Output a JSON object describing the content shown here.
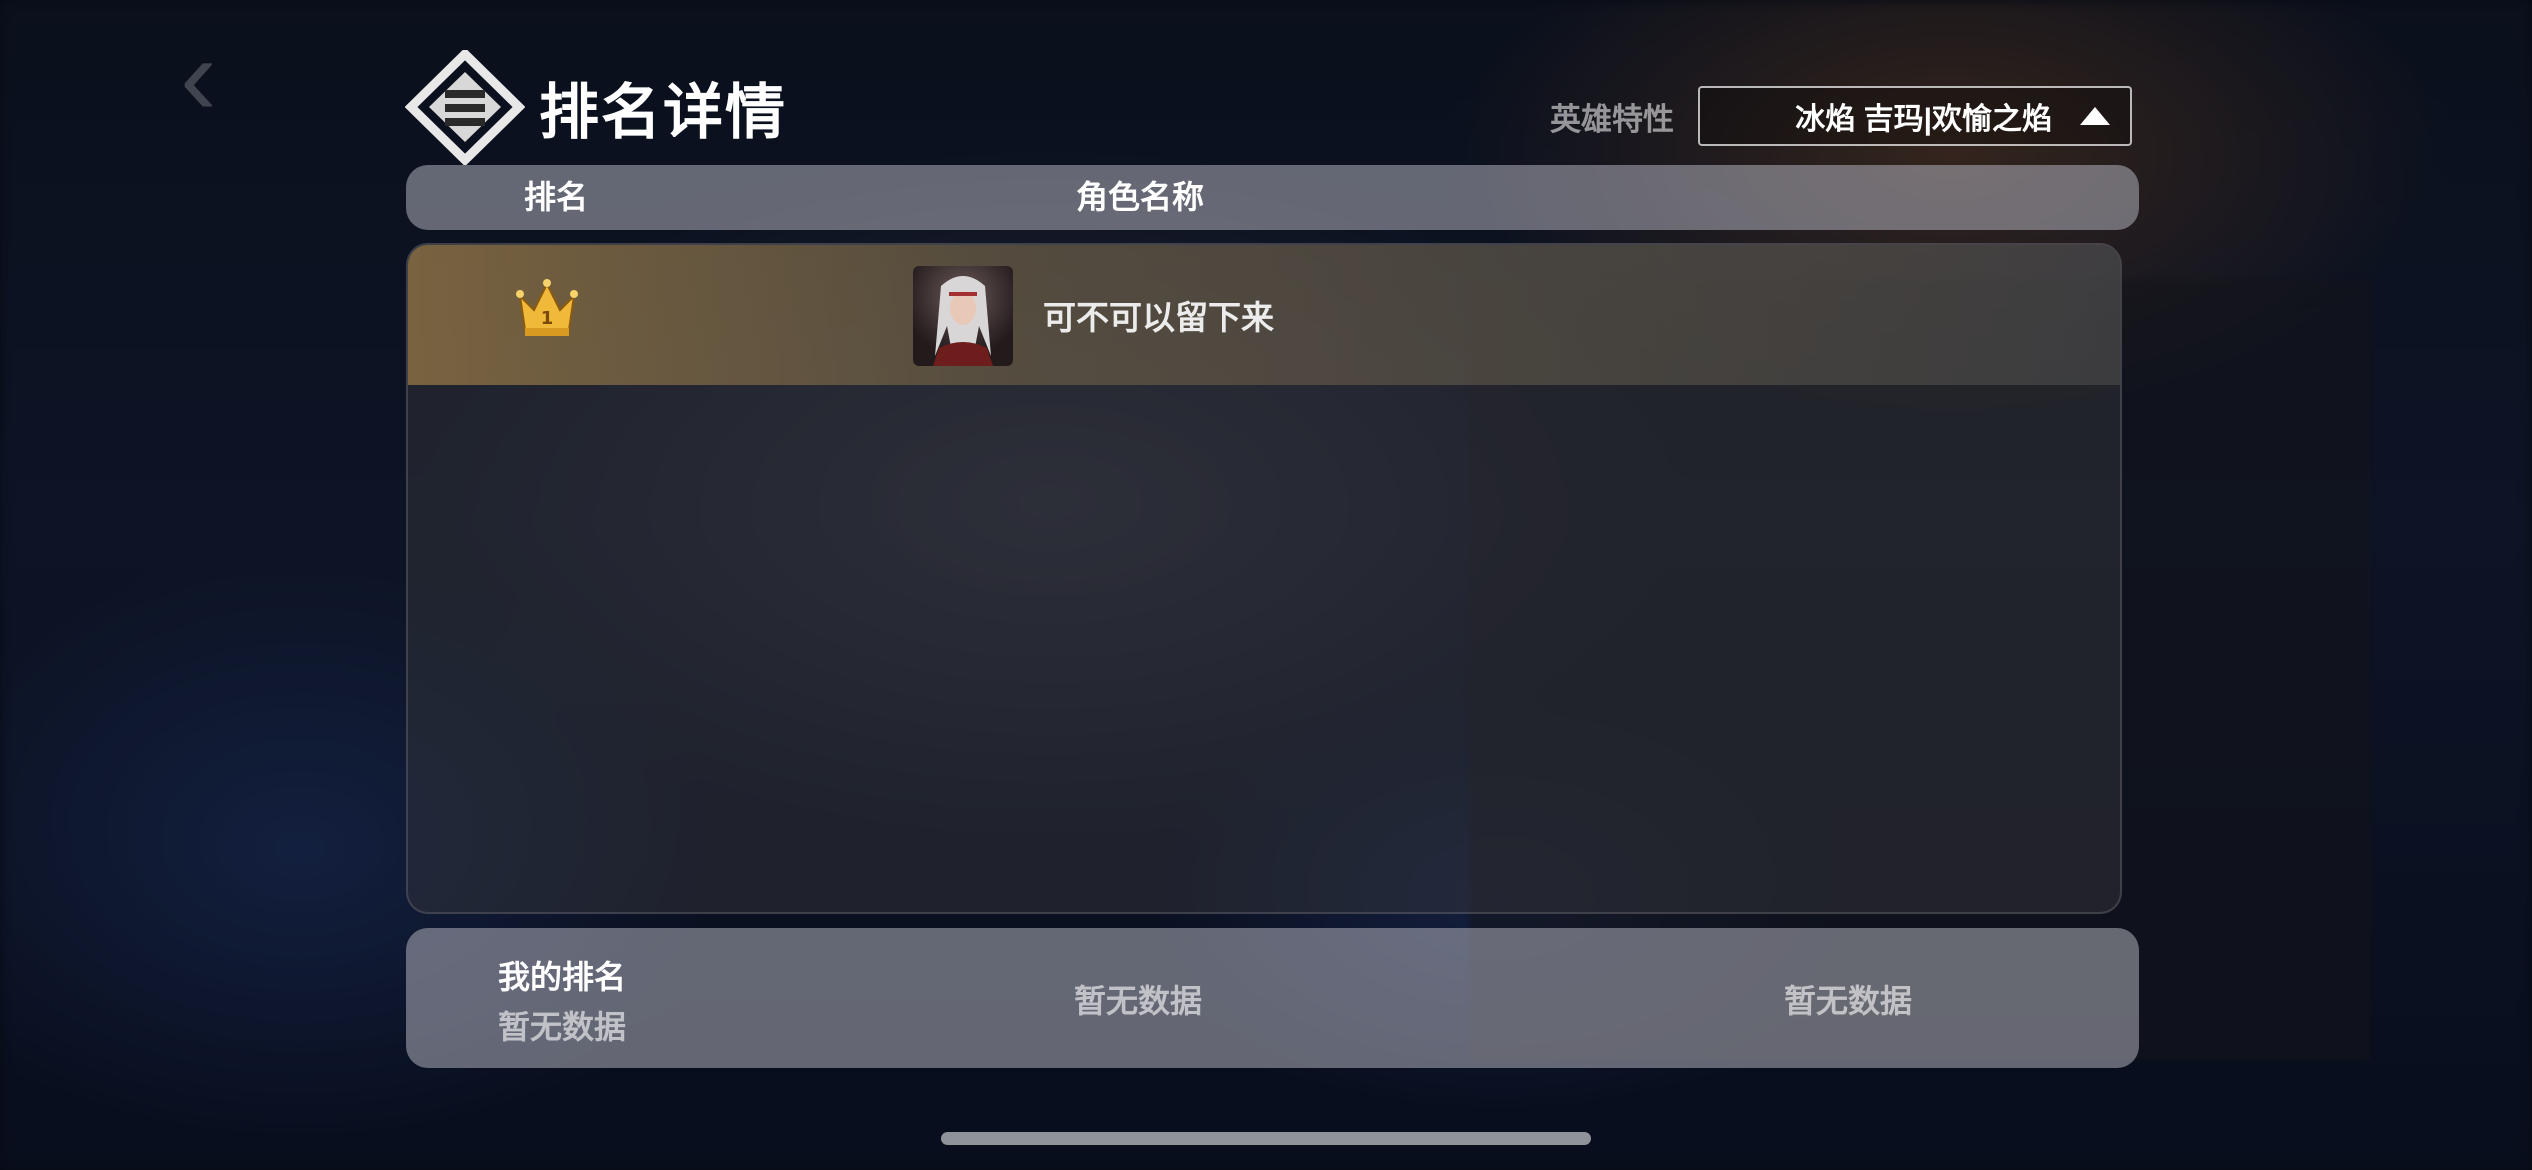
{
  "header": {
    "title": "排名详情",
    "filter_label": "英雄特性",
    "filter_value": "冰焰 吉玛|欢愉之焰"
  },
  "table": {
    "columns": [
      "排名",
      "角色名称"
    ],
    "rows": [
      {
        "rank": 1,
        "name": "可不可以留下来"
      }
    ]
  },
  "my_rank": {
    "label": "我的排名",
    "rank_value": "暂无数据",
    "name_value": "暂无数据",
    "score_value": "暂无数据"
  },
  "colors": {
    "crown": "#f0b93a",
    "first_row_tint": "#96784a"
  },
  "icons": [
    "back-arrow-icon",
    "ranking-logo-icon",
    "caret-up-icon",
    "crown-rank-1-icon",
    "player-avatar"
  ]
}
